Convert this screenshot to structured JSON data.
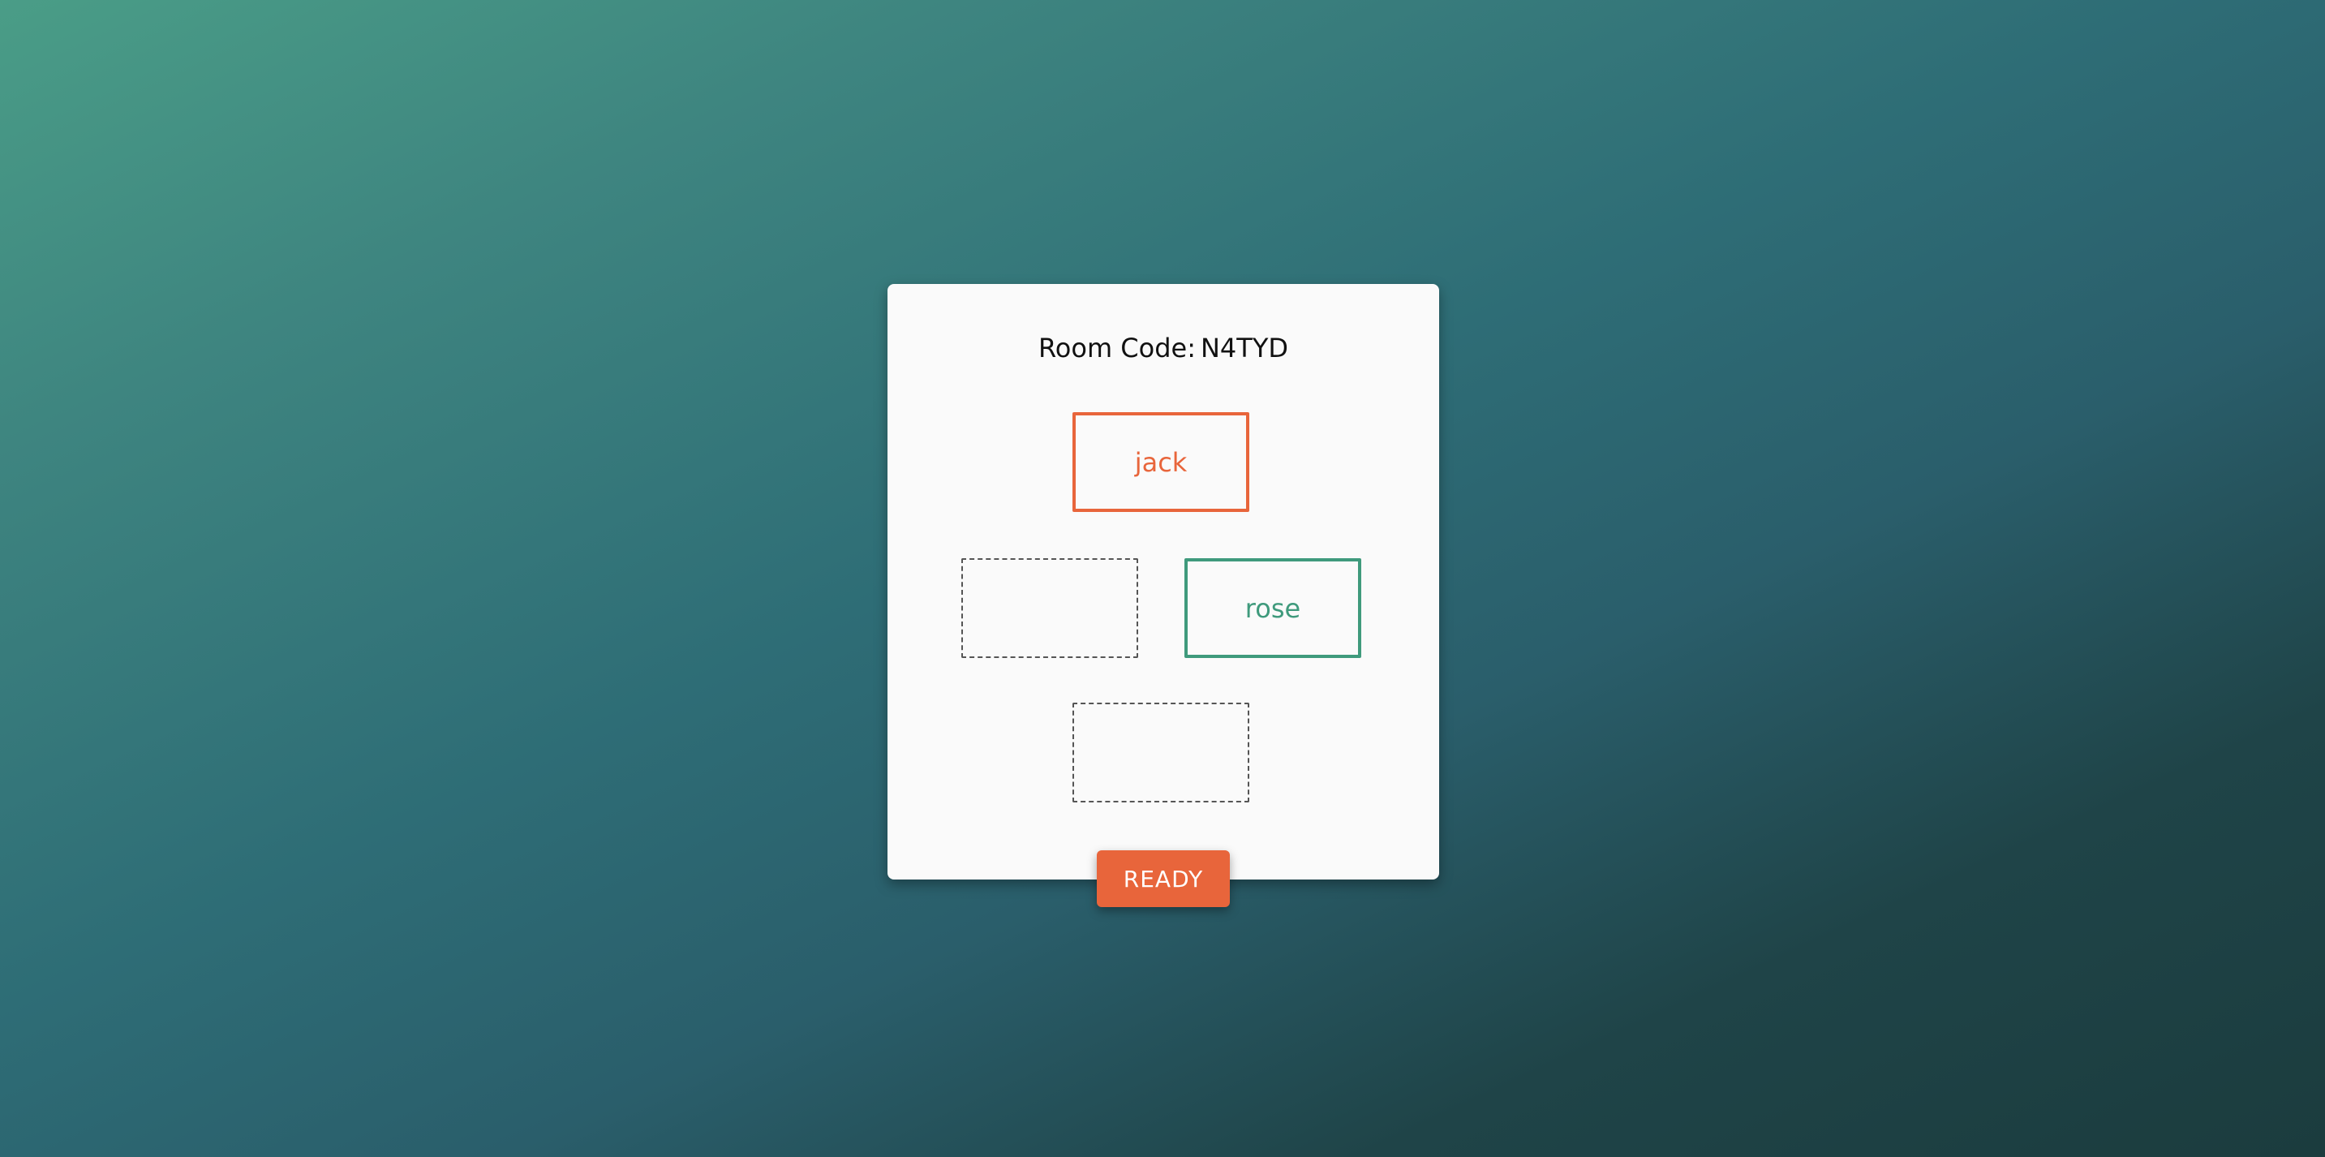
{
  "lobby": {
    "room_code_label": "Room Code:",
    "room_code": "N4TYD"
  },
  "seats": [
    {
      "position": "top",
      "player": "jack",
      "status": "taken",
      "color": "#e8653b"
    },
    {
      "position": "left",
      "player": "",
      "status": "empty"
    },
    {
      "position": "right",
      "player": "rose",
      "status": "taken",
      "color": "#3f9a7c"
    },
    {
      "position": "bottom",
      "player": "",
      "status": "empty"
    }
  ],
  "actions": {
    "ready_label": "READY"
  },
  "colors": {
    "accent": "#e8653b",
    "secondary": "#3f9a7c",
    "card_background": "#fafafa"
  }
}
